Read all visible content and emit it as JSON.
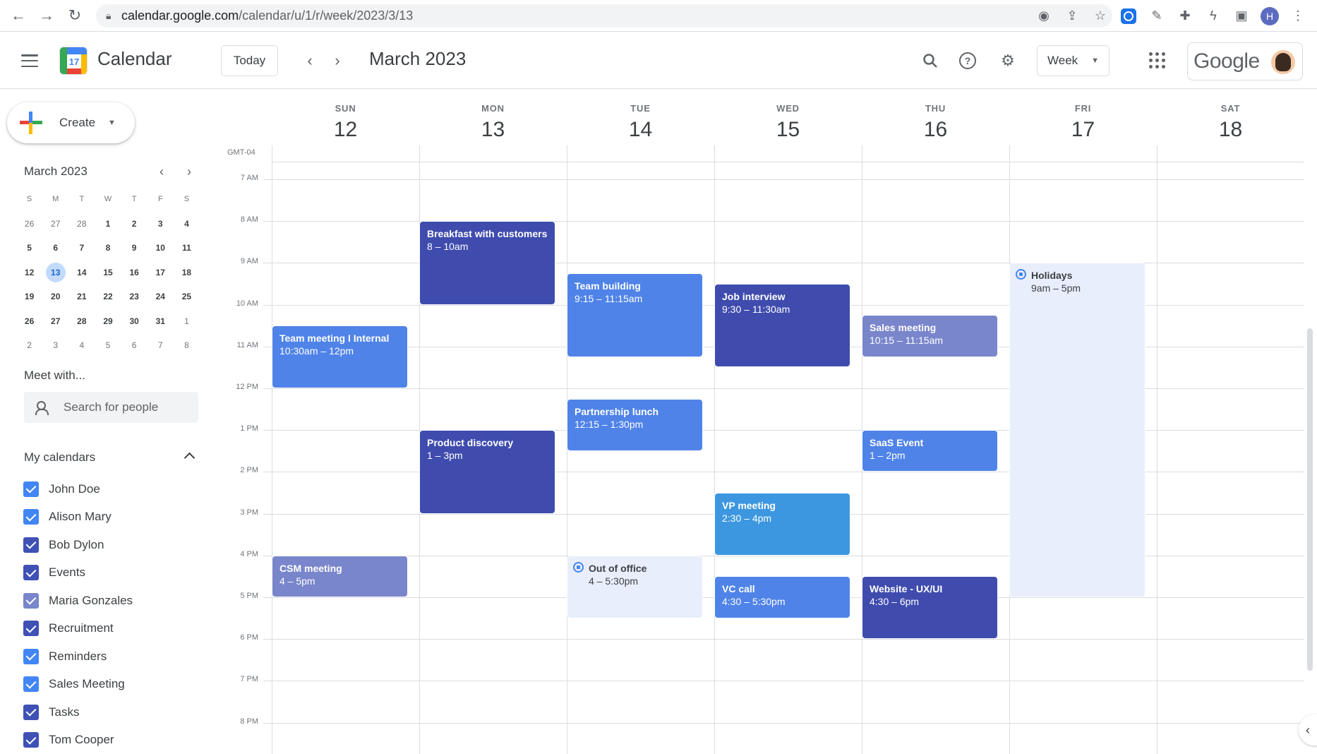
{
  "browser": {
    "url_host": "calendar.google.com",
    "url_path": "/calendar/u/1/r/week/2023/3/13",
    "profile_initial": "H"
  },
  "header": {
    "app_name": "Calendar",
    "logo_day": "17",
    "today_label": "Today",
    "month_title": "March 2023",
    "view_label": "Week",
    "brand": "Google"
  },
  "sidebar": {
    "create_label": "Create",
    "mini_calendar": {
      "title": "March 2023",
      "weekday_heads": [
        "S",
        "M",
        "T",
        "W",
        "T",
        "F",
        "S"
      ],
      "weeks": [
        [
          {
            "d": "26",
            "m": true
          },
          {
            "d": "27",
            "m": true
          },
          {
            "d": "28",
            "m": true
          },
          {
            "d": "1",
            "b": true
          },
          {
            "d": "2",
            "b": true
          },
          {
            "d": "3",
            "b": true
          },
          {
            "d": "4",
            "b": true
          }
        ],
        [
          {
            "d": "5",
            "b": true
          },
          {
            "d": "6",
            "b": true
          },
          {
            "d": "7",
            "b": true
          },
          {
            "d": "8",
            "b": true
          },
          {
            "d": "9",
            "b": true
          },
          {
            "d": "10",
            "b": true
          },
          {
            "d": "11",
            "b": true
          }
        ],
        [
          {
            "d": "12",
            "b": true
          },
          {
            "d": "13",
            "today": true
          },
          {
            "d": "14",
            "b": true
          },
          {
            "d": "15",
            "b": true
          },
          {
            "d": "16",
            "b": true
          },
          {
            "d": "17",
            "b": true
          },
          {
            "d": "18",
            "b": true
          }
        ],
        [
          {
            "d": "19",
            "b": true
          },
          {
            "d": "20",
            "b": true
          },
          {
            "d": "21",
            "b": true
          },
          {
            "d": "22",
            "b": true
          },
          {
            "d": "23",
            "b": true
          },
          {
            "d": "24",
            "b": true
          },
          {
            "d": "25",
            "b": true
          }
        ],
        [
          {
            "d": "26",
            "b": true
          },
          {
            "d": "27",
            "b": true
          },
          {
            "d": "28",
            "b": true
          },
          {
            "d": "29",
            "b": true
          },
          {
            "d": "30",
            "b": true
          },
          {
            "d": "31",
            "b": true
          },
          {
            "d": "1",
            "m": true
          }
        ],
        [
          {
            "d": "2",
            "m": true
          },
          {
            "d": "3",
            "m": true
          },
          {
            "d": "4",
            "m": true
          },
          {
            "d": "5",
            "m": true
          },
          {
            "d": "6",
            "m": true
          },
          {
            "d": "7",
            "m": true
          },
          {
            "d": "8",
            "m": true
          }
        ]
      ]
    },
    "meet_title": "Meet with...",
    "search_people_placeholder": "Search for people",
    "my_calendars_title": "My calendars",
    "calendars": [
      {
        "name": "John Doe",
        "color": "#4285f4"
      },
      {
        "name": "Alison Mary",
        "color": "#4285f4"
      },
      {
        "name": "Bob Dylon",
        "color": "#3f51b5"
      },
      {
        "name": "Events",
        "color": "#3f51b5"
      },
      {
        "name": "Maria Gonzales",
        "color": "#7986cb"
      },
      {
        "name": "Recruitment",
        "color": "#3f51b5"
      },
      {
        "name": "Reminders",
        "color": "#4285f4"
      },
      {
        "name": "Sales Meeting",
        "color": "#4285f4"
      },
      {
        "name": "Tasks",
        "color": "#3f51b5"
      },
      {
        "name": "Tom Cooper",
        "color": "#3f51b5"
      }
    ]
  },
  "week": {
    "timezone": "GMT-04",
    "days": [
      {
        "name": "SUN",
        "num": "12"
      },
      {
        "name": "MON",
        "num": "13"
      },
      {
        "name": "TUE",
        "num": "14"
      },
      {
        "name": "WED",
        "num": "15"
      },
      {
        "name": "THU",
        "num": "16"
      },
      {
        "name": "FRI",
        "num": "17"
      },
      {
        "name": "SAT",
        "num": "18"
      }
    ],
    "first_hour": 7,
    "hours": [
      "7 AM",
      "8 AM",
      "9 AM",
      "10 AM",
      "11 AM",
      "12 PM",
      "1 PM",
      "2 PM",
      "3 PM",
      "4 PM",
      "5 PM",
      "6 PM",
      "7 PM",
      "8 PM"
    ],
    "events": [
      {
        "day": 0,
        "start": 10.5,
        "end": 12,
        "title": "Team meeting I Internal",
        "time": "10:30am – 12pm",
        "color": "#4f83e8"
      },
      {
        "day": 0,
        "start": 16,
        "end": 17,
        "title": "CSM meeting",
        "time": "4 – 5pm",
        "color": "#7986cb"
      },
      {
        "day": 1,
        "start": 8,
        "end": 10,
        "title": "Breakfast with customers",
        "time": "8 – 10am",
        "color": "#3f4cae"
      },
      {
        "day": 1,
        "start": 13,
        "end": 15,
        "title": "Product discovery",
        "time": "1 – 3pm",
        "color": "#3f4cae"
      },
      {
        "day": 2,
        "start": 9.25,
        "end": 11.25,
        "title": "Team building",
        "time": "9:15 – 11:15am",
        "color": "#4f83e8"
      },
      {
        "day": 2,
        "start": 12.25,
        "end": 13.5,
        "title": "Partnership lunch",
        "time": "12:15 – 1:30pm",
        "color": "#4f83e8"
      },
      {
        "day": 2,
        "start": 16,
        "end": 17.5,
        "title": "Out of office",
        "time": "4 – 5:30pm",
        "color": "#e8eefc",
        "light": true,
        "icon": true
      },
      {
        "day": 3,
        "start": 9.5,
        "end": 11.5,
        "title": "Job interview",
        "time": "9:30 – 11:30am",
        "color": "#3f4cae"
      },
      {
        "day": 3,
        "start": 14.5,
        "end": 16,
        "title": "VP meeting",
        "time": "2:30 – 4pm",
        "color": "#3d97e0"
      },
      {
        "day": 3,
        "start": 16.5,
        "end": 17.5,
        "title": "VC call",
        "time": "4:30 – 5:30pm",
        "color": "#4f83e8"
      },
      {
        "day": 4,
        "start": 10.25,
        "end": 11.25,
        "title": "Sales meeting",
        "time": "10:15 – 11:15am",
        "color": "#7986cb"
      },
      {
        "day": 4,
        "start": 13,
        "end": 14,
        "title": "SaaS Event",
        "time": "1 – 2pm",
        "color": "#4f83e8"
      },
      {
        "day": 4,
        "start": 16.5,
        "end": 18,
        "title": "Website - UX/UI",
        "time": "4:30 – 6pm",
        "color": "#3f4cae"
      },
      {
        "day": 5,
        "start": 9,
        "end": 17,
        "title": "Holidays",
        "time": "9am – 5pm",
        "color": "#e8eefc",
        "light": true,
        "icon": true
      }
    ]
  }
}
